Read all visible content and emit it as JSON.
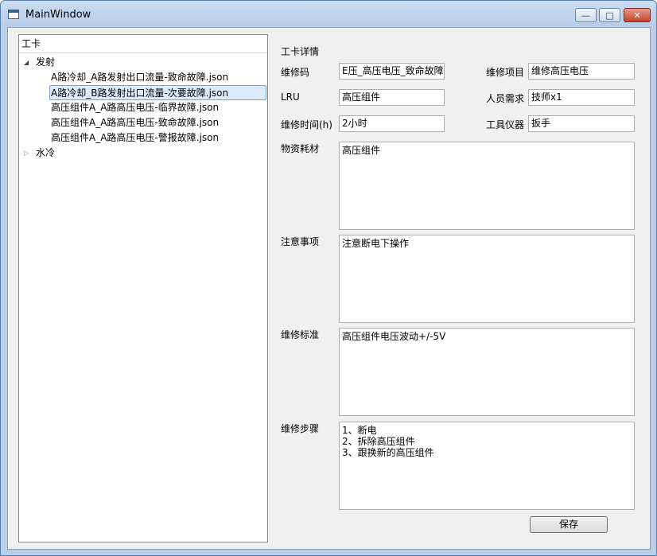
{
  "window": {
    "title": "MainWindow"
  },
  "tree": {
    "header": "工卡",
    "groups": [
      {
        "label": "发射",
        "expanded": true,
        "items": [
          {
            "label": "A路冷却_A路发射出口流量-致命故障.json"
          },
          {
            "label": "A路冷却_B路发射出口流量-次要故障.json",
            "selected": true
          },
          {
            "label": "高压组件A_A路高压电压-临界故障.json"
          },
          {
            "label": "高压组件A_A路高压电压-致命故障.json"
          },
          {
            "label": "高压组件A_A路高压电压-警报故障.json"
          }
        ]
      },
      {
        "label": "水冷",
        "expanded": false,
        "items": []
      }
    ]
  },
  "detail": {
    "title": "工卡详情",
    "repair_code": {
      "label": "维修码",
      "value": "E压_高压电压_致命故障"
    },
    "repair_item": {
      "label": "维修项目",
      "value": "维修高压电压"
    },
    "lru": {
      "label": "LRU",
      "value": "高压组件"
    },
    "staff": {
      "label": "人员需求",
      "value": "技师x1"
    },
    "repair_time": {
      "label": "维修时间(h)",
      "value": "2小时"
    },
    "tools": {
      "label": "工具仪器",
      "value": "扳手"
    },
    "materials": {
      "label": "物资耗材",
      "value": "高压组件"
    },
    "notes": {
      "label": "注意事项",
      "value": "注意断电下操作"
    },
    "standard": {
      "label": "维修标准",
      "value": "高压组件电压波动+/-5V"
    },
    "steps": {
      "label": "维修步骤",
      "value": "1、断电\n2、拆除高压组件\n3、跟换新的高压组件"
    },
    "save_label": "保存"
  }
}
